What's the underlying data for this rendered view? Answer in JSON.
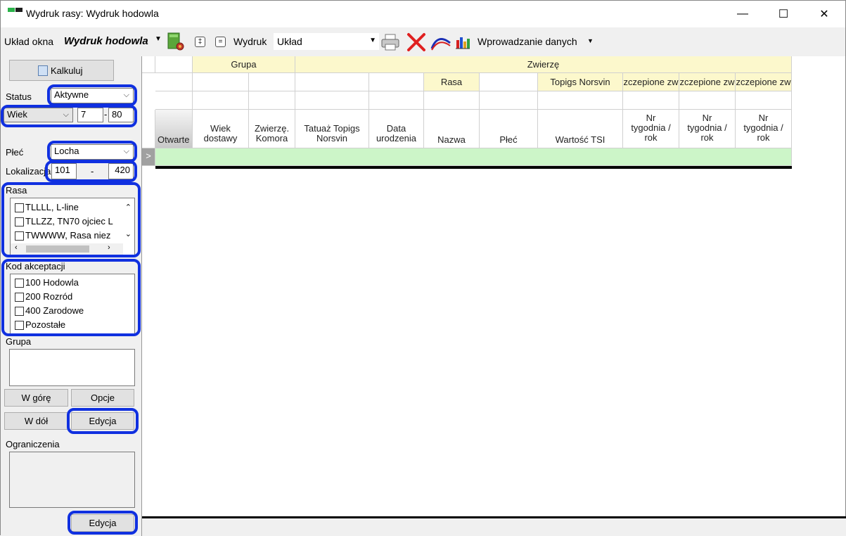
{
  "window": {
    "title": "Wydruk rasy: Wydruk hodowla",
    "minimize": "—",
    "maximize": "☐",
    "close": "✕"
  },
  "toolbar": {
    "layout_label": "Układ okna",
    "layout_value": "Wydruk hodowla",
    "plus_button": "‡",
    "minus_button": "=",
    "print_label": "Wydruk",
    "print_layout_value": "Układ",
    "data_entry_label": "Wprowadzanie danych"
  },
  "left": {
    "calc_button": "Kalkuluj",
    "status_label": "Status",
    "status_value": "Aktywne",
    "age_select": "Wiek",
    "age_from": "7",
    "age_dash": "-",
    "age_to": "80",
    "sex_label": "Płeć",
    "sex_value": "Locha",
    "location_label": "Lokalizacja",
    "location_from": "101",
    "location_dash": "-",
    "location_to": "420",
    "breed_label": "Rasa",
    "breed_items": [
      "TLLLL, L-line",
      "TLLZZ, TN70 ojciec L",
      "TWWWW, Rasa niez"
    ],
    "accept_label": "Kod akceptacji",
    "accept_items": [
      "100 Hodowla",
      "200 Rozród",
      "400 Zarodowe",
      "Pozostałe"
    ],
    "group_label": "Grupa",
    "up_button": "W górę",
    "options_button": "Opcje",
    "down_button": "W dół",
    "edit_button": "Edycja",
    "constraints_label": "Ograniczenia",
    "edit_button2": "Edycja"
  },
  "grid": {
    "group_header": "Grupa",
    "animal_header": "Zwierzę",
    "breed_header": "Rasa",
    "topigs_header": "Topigs Norsvin",
    "crossed_header": "zczepione zw",
    "columns": [
      "Otwarte",
      "Wiek dostawy",
      "Zwierzę. Komora",
      "Tatuaż Topigs Norsvin",
      "Data urodzenia",
      "Nazwa",
      "Płeć",
      "Wartość TSI",
      "Nr tygodnia / rok",
      "Nr tygodnia / rok",
      "Nr tygodnia / rok"
    ],
    "row_marker": ">"
  }
}
